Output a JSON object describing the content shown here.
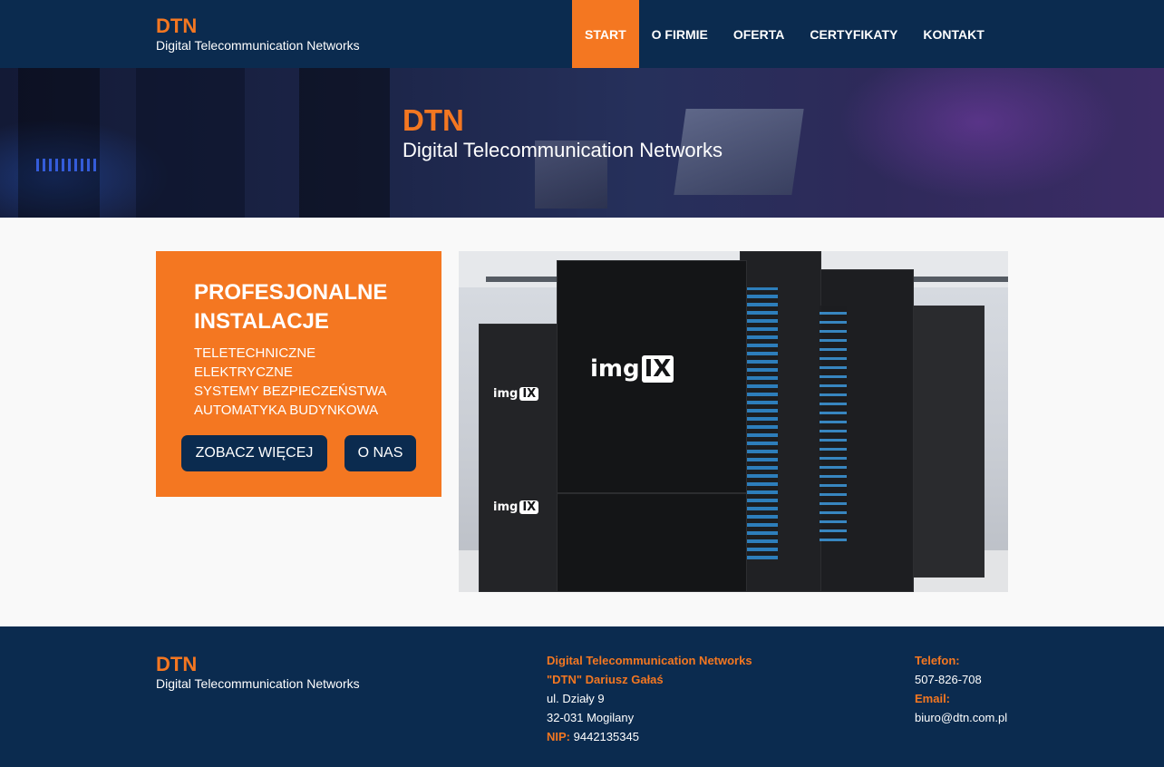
{
  "header": {
    "logo_title": "DTN",
    "logo_subtitle": "Digital Telecommunication Networks",
    "nav": [
      {
        "label": "START",
        "active": true
      },
      {
        "label": "O FIRMIE"
      },
      {
        "label": "OFERTA"
      },
      {
        "label": "CERTYFIKATY"
      },
      {
        "label": "KONTAKT"
      }
    ]
  },
  "hero": {
    "title": "DTN",
    "subtitle": "Digital Telecommunication Networks"
  },
  "promo": {
    "title_line1": "PROFESJONALNE",
    "title_line2": "INSTALACJE",
    "items": [
      "TELETECHNICZNE",
      "ELEKTRYCZNE",
      "SYSTEMY BEZPIECZEŃSTWA",
      "AUTOMATYKA BUDYNKOWA"
    ],
    "more_button": "ZOBACZ WIĘCEJ",
    "about_button": "O NAS"
  },
  "photo": {
    "badge_main": "img",
    "badge_box": "IX"
  },
  "footer": {
    "logo_title": "DTN",
    "logo_subtitle": "Digital Telecommunication Networks",
    "company": "Digital Telecommunication Networks",
    "owner": "\"DTN\" Dariusz Gałaś",
    "street": "ul. Działy 9",
    "city": "32-031 Mogilany",
    "nip_label": "NIP:",
    "nip_value": "9442135345",
    "phone_label": "Telefon:",
    "phone": "507-826-708",
    "email_label": "Email:",
    "email": "biuro@dtn.com.pl"
  },
  "colors": {
    "navy": "#0b2b4f",
    "orange": "#f47721",
    "background": "#f9f9f9"
  }
}
